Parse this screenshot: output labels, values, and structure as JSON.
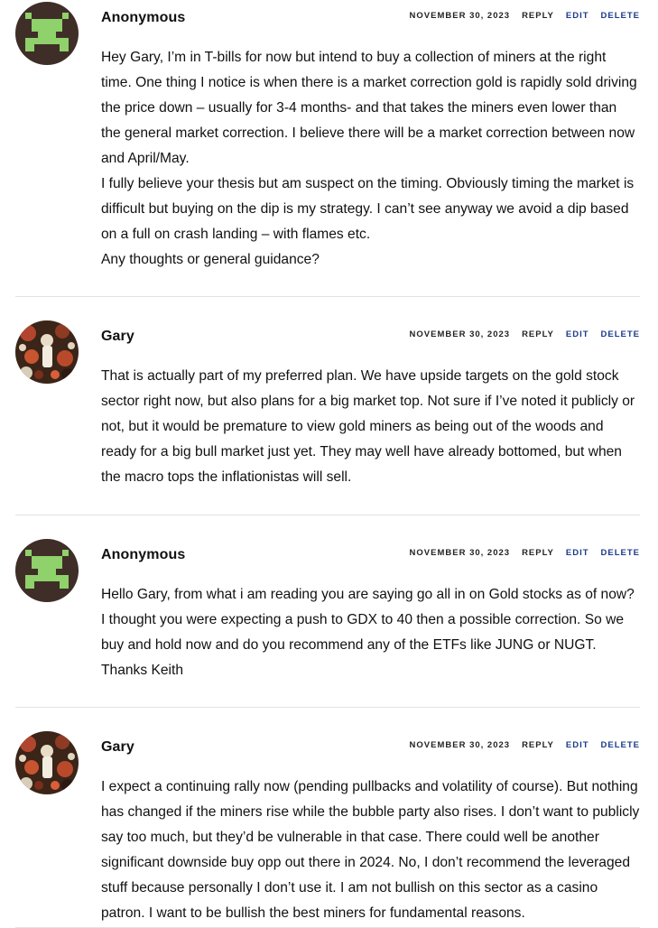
{
  "comments": [
    {
      "author": "Anonymous",
      "avatar": "pixel-invader-avatar",
      "date": "NOVEMBER 30, 2023",
      "reply": "REPLY",
      "edit": "EDIT",
      "delete": "DELETE",
      "paragraphs": [
        "Hey Gary, I’m in T-bills for now but intend to buy a collection of miners at the right time. One thing I notice is when there is a market correction gold is rapidly sold driving the price down – usually for 3-4 months- and that takes the miners even lower than the general market correction. I believe there will be a market correction between now and April/May.",
        "I fully believe your thesis but am suspect on the timing. Obviously timing the market is difficult but buying on the dip is my strategy. I can’t see anyway we avoid a dip based on a full on crash landing – with flames etc.",
        "Any thoughts or general guidance?"
      ]
    },
    {
      "author": "Gary",
      "avatar": "painting-avatar",
      "date": "NOVEMBER 30, 2023",
      "reply": "REPLY",
      "edit": "EDIT",
      "delete": "DELETE",
      "paragraphs": [
        "That is actually part of my preferred plan. We have upside targets on the gold stock sector right now, but also plans for a big market top. Not sure if I’ve noted it publicly or not, but it would be premature to view gold miners as being out of the woods and ready for a big bull market just yet. They may well have already bottomed, but when the macro tops the inflationistas will sell."
      ]
    },
    {
      "author": "Anonymous",
      "avatar": "pixel-invader-avatar",
      "date": "NOVEMBER 30, 2023",
      "reply": "REPLY",
      "edit": "EDIT",
      "delete": "DELETE",
      "paragraphs": [
        "Hello Gary, from what i am reading you are saying go all in on Gold stocks as of now? I thought you were expecting a push to GDX to 40 then a possible correction. So we buy and hold now and do you recommend any of the ETFs like JUNG or NUGT. Thanks Keith"
      ]
    },
    {
      "author": "Gary",
      "avatar": "painting-avatar",
      "date": "NOVEMBER 30, 2023",
      "reply": "REPLY",
      "edit": "EDIT",
      "delete": "DELETE",
      "paragraphs": [
        "I expect a continuing rally now (pending pullbacks and volatility of course). But nothing has changed if the miners rise while the bubble party also rises. I don’t want to publicly say too much, but they’d be vulnerable in that case. There could well be another significant downside buy opp out there in 2024. No, I don’t recommend the leveraged stuff because personally I don’t use it. I am not bullish on this sector as a casino patron. I want to be bullish the best miners for fundamental reasons."
      ]
    }
  ]
}
